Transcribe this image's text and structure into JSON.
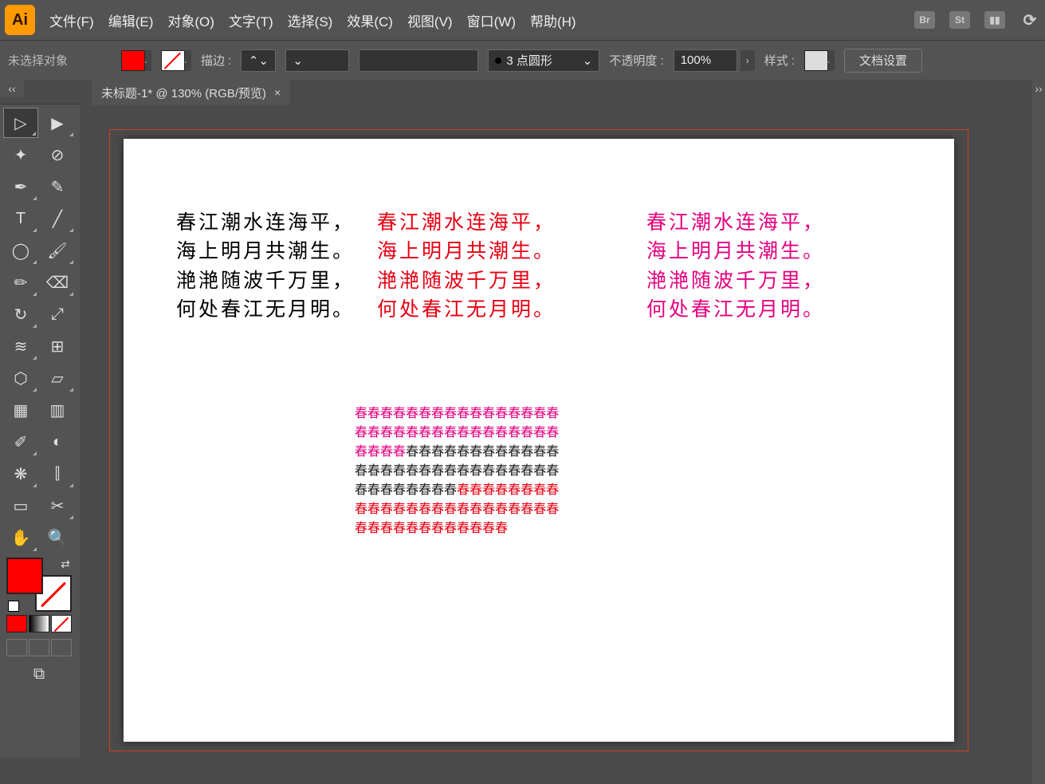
{
  "app": {
    "name": "Ai"
  },
  "menu": {
    "items": [
      "文件(F)",
      "编辑(E)",
      "对象(O)",
      "文字(T)",
      "选择(S)",
      "效果(C)",
      "视图(V)",
      "窗口(W)",
      "帮助(H)"
    ]
  },
  "menubar_icons": {
    "br": "Br",
    "st": "St"
  },
  "control": {
    "selection_status": "未选择对象",
    "stroke_label": "描边 :",
    "stroke_profile": "3 点圆形",
    "opacity_label": "不透明度 :",
    "opacity_value": "100%",
    "style_label": "样式 :",
    "doc_setup": "文档设置"
  },
  "tab": {
    "title": "未标题-1* @ 130% (RGB/预览)",
    "close": "×"
  },
  "dock": {
    "collapse_left": "‹‹",
    "collapse_right": "››"
  },
  "tools": [
    {
      "name": "selection-tool",
      "glyph": "▷",
      "tri": true,
      "selected": true
    },
    {
      "name": "direct-selection-tool",
      "glyph": "▶",
      "tri": true
    },
    {
      "name": "magic-wand-tool",
      "glyph": "✦",
      "tri": false
    },
    {
      "name": "lasso-tool",
      "glyph": "⊘",
      "tri": false
    },
    {
      "name": "pen-tool",
      "glyph": "✒",
      "tri": true
    },
    {
      "name": "curvature-tool",
      "glyph": "✎",
      "tri": false
    },
    {
      "name": "type-tool",
      "glyph": "T",
      "tri": true
    },
    {
      "name": "line-tool",
      "glyph": "╱",
      "tri": true
    },
    {
      "name": "ellipse-tool",
      "glyph": "◯",
      "tri": true
    },
    {
      "name": "brush-tool",
      "glyph": "🖌",
      "tri": true
    },
    {
      "name": "pencil-tool",
      "glyph": "✏",
      "tri": true
    },
    {
      "name": "eraser-tool",
      "glyph": "⌫",
      "tri": true
    },
    {
      "name": "rotate-tool",
      "glyph": "↻",
      "tri": true
    },
    {
      "name": "scale-tool",
      "glyph": "⤢",
      "tri": false
    },
    {
      "name": "width-tool",
      "glyph": "≋",
      "tri": true
    },
    {
      "name": "free-transform-tool",
      "glyph": "⊞",
      "tri": false
    },
    {
      "name": "shape-builder-tool",
      "glyph": "⬡",
      "tri": true
    },
    {
      "name": "perspective-tool",
      "glyph": "▱",
      "tri": true
    },
    {
      "name": "mesh-tool",
      "glyph": "▦",
      "tri": false
    },
    {
      "name": "gradient-tool",
      "glyph": "▥",
      "tri": false
    },
    {
      "name": "eyedropper-tool",
      "glyph": "✐",
      "tri": true
    },
    {
      "name": "blend-tool",
      "glyph": "◐",
      "tri": false
    },
    {
      "name": "symbol-sprayer-tool",
      "glyph": "❋",
      "tri": true
    },
    {
      "name": "graph-tool",
      "glyph": "⫿",
      "tri": true
    },
    {
      "name": "artboard-tool",
      "glyph": "▭",
      "tri": false
    },
    {
      "name": "slice-tool",
      "glyph": "✂",
      "tri": true
    },
    {
      "name": "hand-tool",
      "glyph": "✋",
      "tri": true
    },
    {
      "name": "zoom-tool",
      "glyph": "🔍",
      "tri": false
    }
  ],
  "poem": {
    "lines": [
      "春江潮水连海平，",
      "海上明月共潮生。",
      "滟滟随波千万里，",
      "何处春江无月明。"
    ],
    "colors": {
      "col1": "#000000",
      "col2": "#e60012",
      "col3": "#e4007f"
    }
  },
  "scroll": {
    "h_thumb": "",
    "v_thumb": ""
  }
}
